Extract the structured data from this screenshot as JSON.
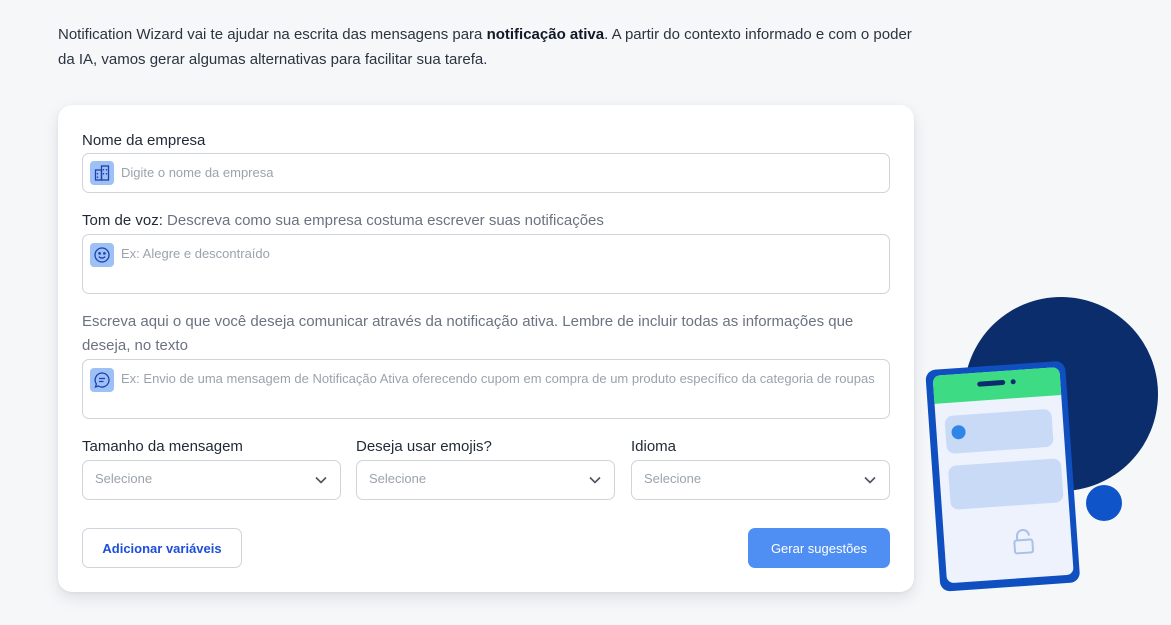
{
  "intro": {
    "text_before": "Notification Wizard vai te ajudar na escrita das mensagens para ",
    "bold": "notificação ativa",
    "text_after": ". A partir do contexto informado e com o poder da IA, vamos gerar algumas alternativas para facilitar sua tarefa."
  },
  "form": {
    "company": {
      "label": "Nome da empresa",
      "placeholder": "Digite o nome da empresa",
      "icon": "building-icon"
    },
    "tone": {
      "label": "Tom de voz:",
      "hint": " Descreva como sua empresa costuma escrever suas notificações",
      "placeholder": "Ex: Alegre e descontraído",
      "icon": "smiley-icon"
    },
    "message": {
      "label": "Escreva aqui o que você deseja comunicar através da notificação ativa. Lembre de incluir todas as informações que deseja, no texto",
      "placeholder": "Ex: Envio de uma mensagem de Notificação Ativa oferecendo cupom em compra de um produto específico da categoria de roupas",
      "icon": "message-icon"
    },
    "size": {
      "label": "Tamanho da mensagem",
      "value": "Selecione"
    },
    "emojis": {
      "label": "Deseja usar emojis?",
      "value": "Selecione"
    },
    "language": {
      "label": "Idioma",
      "value": "Selecione"
    },
    "add_variables_label": "Adicionar variáveis",
    "generate_label": "Gerar sugestões"
  },
  "colors": {
    "primary": "#4f8ef3",
    "link": "#1d4ed8",
    "illustration_navy": "#0b2d6b",
    "illustration_green": "#3ddc84",
    "illustration_blue": "#0f55c9"
  }
}
